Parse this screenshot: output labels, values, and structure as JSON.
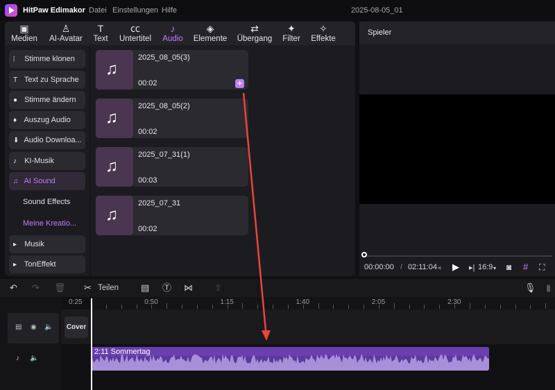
{
  "titlebar": {
    "app_name": "HitPaw Edimakor",
    "menu": [
      "Datei",
      "Einstellungen",
      "Hilfe"
    ],
    "project": "2025-08-05_01"
  },
  "toolbar": {
    "tools": [
      {
        "label": "Medien",
        "icon": "media-icon",
        "glyph": "▣"
      },
      {
        "label": "AI-Avatar",
        "icon": "ai-avatar-icon",
        "glyph": "♙"
      },
      {
        "label": "Text",
        "icon": "text-icon",
        "glyph": "T"
      },
      {
        "label": "Untertitel",
        "icon": "subtitle-icon",
        "glyph": "㏄"
      },
      {
        "label": "Audio",
        "icon": "audio-icon",
        "glyph": "♪"
      },
      {
        "label": "Elemente",
        "icon": "elements-icon",
        "glyph": "◈"
      },
      {
        "label": "Übergang",
        "icon": "transition-icon",
        "glyph": "⇄"
      },
      {
        "label": "Filter",
        "icon": "filter-icon",
        "glyph": "✦"
      },
      {
        "label": "Effekte",
        "icon": "effects-icon",
        "glyph": "✧"
      }
    ],
    "active": "Audio"
  },
  "categories": [
    {
      "label": "Stimme klonen",
      "icon": "waveform-icon",
      "glyph": "⦙"
    },
    {
      "label": "Text zu Sprache",
      "icon": "text-to-speech-icon",
      "glyph": "T"
    },
    {
      "label": "Stimme ändern",
      "icon": "voice-change-icon",
      "glyph": "●"
    },
    {
      "label": "Auszug Audio",
      "icon": "microphone-icon",
      "glyph": "♦"
    },
    {
      "label": "Audio Downloa...",
      "icon": "download-icon",
      "glyph": "⬇"
    },
    {
      "label": "KI-Musik",
      "icon": "ai-music-icon",
      "glyph": "♪"
    },
    {
      "label": "AI Sound",
      "icon": "ai-sound-icon",
      "glyph": "♫"
    },
    {
      "label": "Sound Effects",
      "icon": "",
      "glyph": ""
    },
    {
      "label": "Meine Kreatio...",
      "icon": "",
      "glyph": ""
    },
    {
      "label": "Musik",
      "icon": "caret-right-icon",
      "glyph": "▸"
    },
    {
      "label": "TonEffekt",
      "icon": "caret-right-icon",
      "glyph": "▸"
    }
  ],
  "audio_items": [
    {
      "name": "2025_08_05(3)",
      "duration": "00:02"
    },
    {
      "name": "2025_08_05(2)",
      "duration": "00:02"
    },
    {
      "name": "2025_07_31(1)",
      "duration": "00:03"
    },
    {
      "name": "2025_07_31",
      "duration": "00:02"
    }
  ],
  "add_button_glyph": "+",
  "player": {
    "title": "Spieler",
    "current_time": "00:00:00",
    "separator": "/",
    "total_time": "02:11:04",
    "aspect_ratio": "16:9",
    "position_fraction": 0.0
  },
  "timeline_toolbar": {
    "split_label": "Teilen"
  },
  "ruler_labels": [
    "0:25",
    "0:50",
    "1:15",
    "1:40",
    "2:05",
    "2:30"
  ],
  "track_cover_label": "Cover",
  "audio_clip": {
    "label": "2:11 Sommertag"
  },
  "colors": {
    "accent": "#c07cff",
    "clip": "#5a3a9a",
    "arrow": "#e8453c"
  }
}
